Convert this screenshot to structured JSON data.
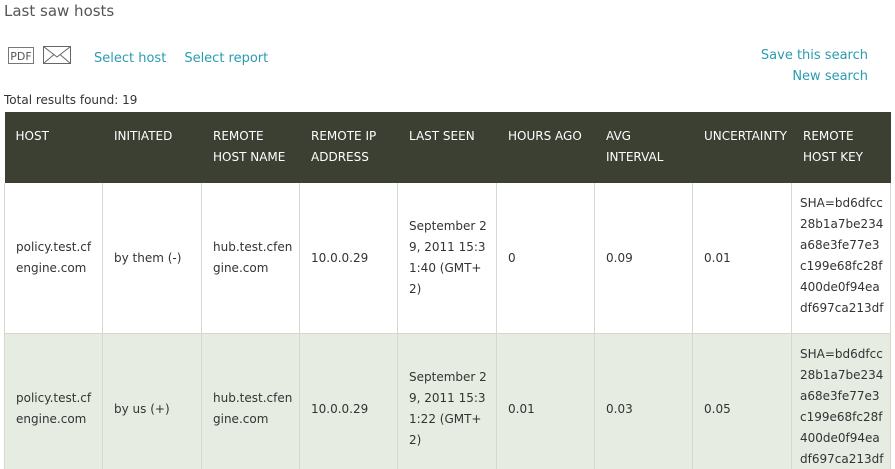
{
  "page": {
    "title": "Last saw hosts"
  },
  "toolbar": {
    "pdf_label": "PDF",
    "select_host": "Select host",
    "select_report": "Select report",
    "save_search": "Save this search",
    "new_search": "New search"
  },
  "results": {
    "total_label": "Total results found: 19"
  },
  "table": {
    "columns": [
      "HOST",
      "INITIATED",
      "REMOTE HOST NAME",
      "REMOTE IP ADDRESS",
      "LAST SEEN",
      "HOURS AGO",
      "AVG INTERVAL",
      "UNCERTAINTY",
      "REMOTE HOST KEY"
    ],
    "rows": [
      {
        "host": "policy.test.cfengine.com",
        "initiated": "by them (-)",
        "remote_host_name": "hub.test.cfengine.com",
        "remote_ip": "10.0.0.29",
        "last_seen": "September 29, 2011 15:31:40 (GMT+2)",
        "hours_ago": "0",
        "avg_interval": "0.09",
        "uncertainty": "0.01",
        "remote_key": "SHA=bd6dfcc28b1a7be234a68e3fe77e3c199e68fc28f400de0f94eadf697ca213df"
      },
      {
        "host": "policy.test.cfengine.com",
        "initiated": "by us (+)",
        "remote_host_name": "hub.test.cfengine.com",
        "remote_ip": "10.0.0.29",
        "last_seen": "September 29, 2011 15:31:22 (GMT+2)",
        "hours_ago": "0.01",
        "avg_interval": "0.03",
        "uncertainty": "0.05",
        "remote_key": "SHA=bd6dfcc28b1a7be234a68e3fe77e3c199e68fc28f400de0f94eadf697ca213df"
      }
    ]
  },
  "colors": {
    "header_bg": "#3b4032",
    "link": "#2a9bb0",
    "alt_row": "#e6ece2"
  },
  "icons": {
    "pdf": "pdf-icon",
    "email": "envelope-icon"
  }
}
